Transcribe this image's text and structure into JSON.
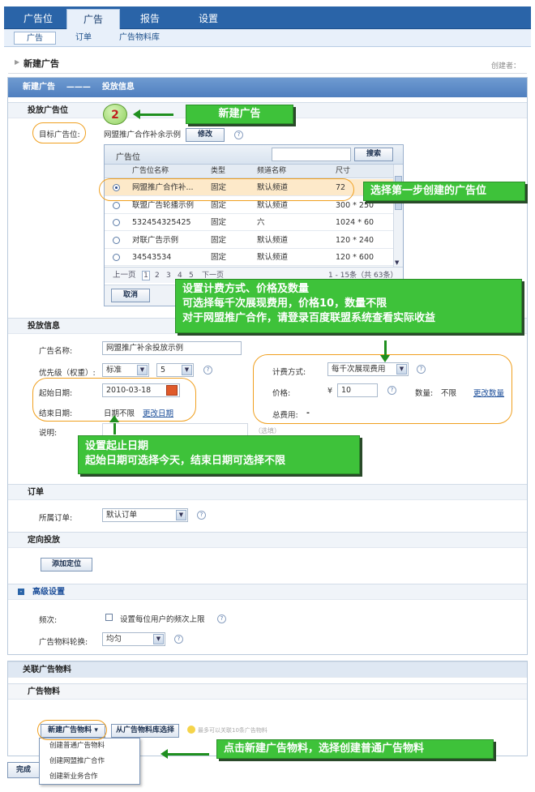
{
  "topnav": {
    "tabs": [
      "广告位",
      "广告",
      "报告",
      "设置"
    ],
    "active": 1
  },
  "subnav": {
    "items": [
      "广告",
      "订单",
      "广告物料库"
    ],
    "active": 0
  },
  "page": {
    "title": "新建广告",
    "creator_label": "创建者："
  },
  "steps": {
    "bar_text": "新建广告    ———    投放信息"
  },
  "placement": {
    "section_title": "投放广告位",
    "target_label": "目标广告位:",
    "target_value": "网盟推广合作补余示例",
    "modify_button": "修改",
    "grid": {
      "title": "广告位",
      "search_button": "搜索",
      "columns": [
        "广告位名称",
        "类型",
        "频道名称",
        "尺寸"
      ],
      "rows": [
        {
          "name": "网盟推广合作补...",
          "type": "固定",
          "channel": "默认频道",
          "size": "72",
          "selected": true
        },
        {
          "name": "联盟广告轮播示例",
          "type": "固定",
          "channel": "默认频道",
          "size": "300 * 250",
          "selected": false
        },
        {
          "name": "532454325425",
          "type": "固定",
          "channel": "六",
          "size": "1024 * 60",
          "selected": false
        },
        {
          "name": "对联广告示例",
          "type": "固定",
          "channel": "默认频道",
          "size": "120 * 240",
          "selected": false
        },
        {
          "name": "34543534",
          "type": "固定",
          "channel": "默认频道",
          "size": "120 * 600",
          "selected": false
        }
      ],
      "pager": {
        "prev": "上一页",
        "pages": [
          "1",
          "2",
          "3",
          "4",
          "5"
        ],
        "next": "下一页",
        "summary": "1 - 15条（共 63条）"
      },
      "cancel_button": "取消"
    }
  },
  "info": {
    "section_title": "投放信息",
    "ad_name_label": "广告名称:",
    "ad_name_value": "网盟推广补余投放示例",
    "priority_label": "优先级（权重）:",
    "priority_value": "标准",
    "weight_value": "5",
    "start_label": "起始日期:",
    "start_value": "2010-03-18",
    "end_label": "结束日期:",
    "end_value": "日期不限",
    "end_change_link": "更改日期",
    "note_label": "说明:",
    "note_hint": "（选填）",
    "billing_label": "计费方式:",
    "billing_value": "每千次展现费用",
    "price_label": "价格:",
    "price_currency": "¥",
    "price_value": "10",
    "qty_label": "数量:",
    "qty_value": "不限",
    "qty_change_link": "更改数量",
    "total_label": "总费用:",
    "total_value": "-"
  },
  "order": {
    "section_title": "订单",
    "label": "所属订单:",
    "value": "默认订单"
  },
  "targeting": {
    "section_title": "定向投放",
    "add_button": "添加定位"
  },
  "advanced": {
    "section_title": "高级设置",
    "freq_label": "频次:",
    "freq_checkbox": "设置每位用户的频次上限",
    "rotation_label": "广告物料轮换:",
    "rotation_value": "均匀"
  },
  "material": {
    "bar_title": "关联广告物料",
    "section_title": "广告物料",
    "new_button": "新建广告物料",
    "library_button": "从广告物料库选择",
    "limit_hint": "最多可以关联10条广告物料",
    "dropdown": [
      "创建普通广告物料",
      "创建网盟推广合作",
      "创建新业务合作"
    ]
  },
  "finish_button": "完成",
  "callouts": {
    "step_number": "2",
    "new_ad": "新建广告",
    "select_slot": "选择第一步创建的广告位",
    "pricing_1": "设置计费方式、价格及数量",
    "pricing_2": "可选择每千次展现费用，价格10，数量不限",
    "pricing_3": "对于网盟推广合作，请登录百度联盟系统查看实际收益",
    "dates_1": "设置起止日期",
    "dates_2": "起始日期可选择今天，结束日期可选择不限",
    "material": "点击新建广告物料，选择创建普通广告物料"
  },
  "colors": {
    "nav_blue": "#2a64a8",
    "callout_green": "#3ec23a",
    "oval_orange": "#f0a020",
    "selected_row": "#fde9c9"
  }
}
